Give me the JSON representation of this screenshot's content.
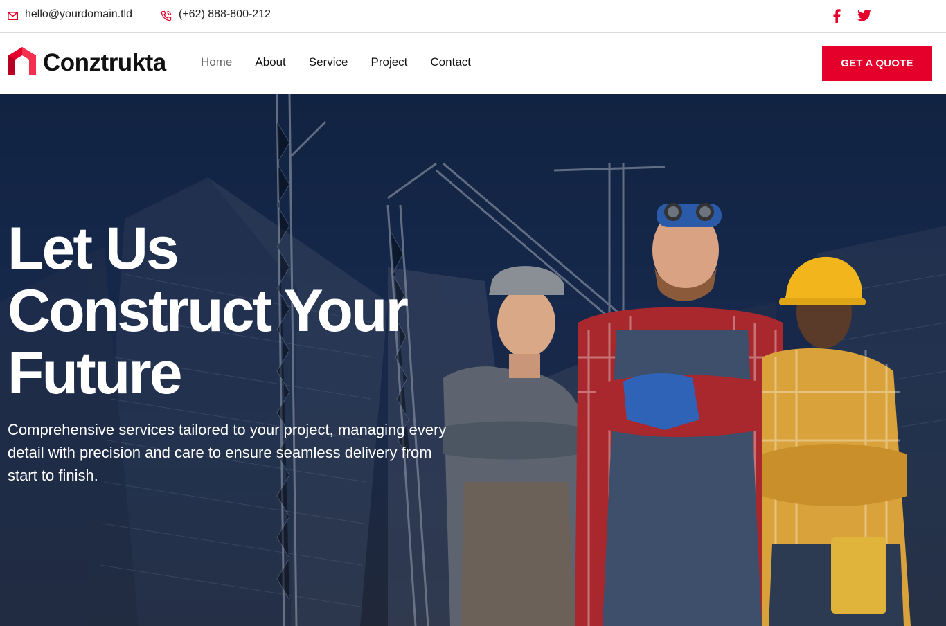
{
  "topbar": {
    "email": "hello@yourdomain.tld",
    "phone": "(+62) 888-800-212",
    "social": [
      "facebook-icon",
      "twitter-icon"
    ]
  },
  "header": {
    "logo_text": "Conztrukta",
    "nav": [
      {
        "label": "Home",
        "active": true
      },
      {
        "label": "About",
        "active": false
      },
      {
        "label": "Service",
        "active": false
      },
      {
        "label": "Project",
        "active": false
      },
      {
        "label": "Contact",
        "active": false
      }
    ],
    "cta_label": "GET A QUOTE"
  },
  "hero": {
    "title_line1": "Let Us",
    "title_line2": "Construct Your",
    "title_line3": "Future",
    "subtitle": "Comprehensive services tailored to your project, managing every detail with precision and care to ensure seamless delivery from start to finish."
  },
  "colors": {
    "accent": "#e4002b",
    "hero_bg": "#1b3158",
    "text_dark": "#111111",
    "nav_active": "#666666"
  }
}
